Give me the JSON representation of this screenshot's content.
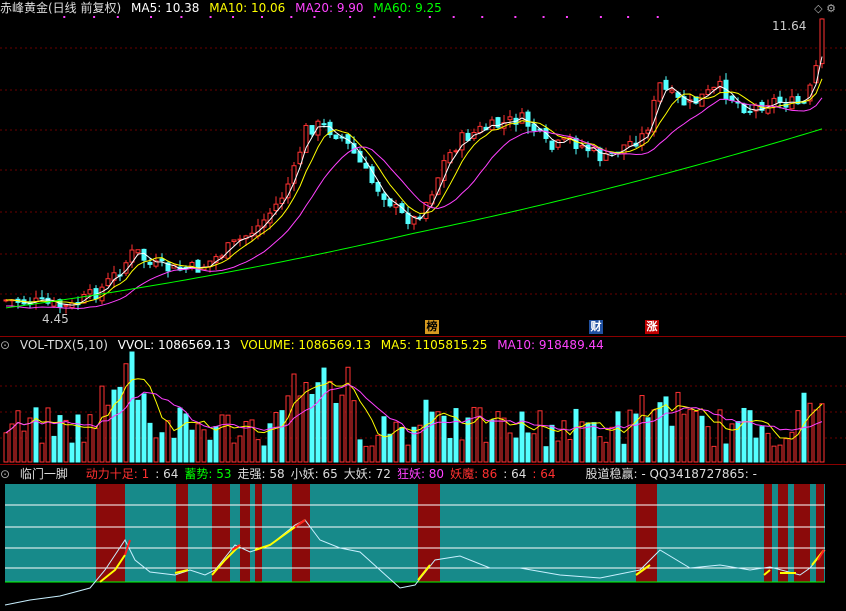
{
  "main": {
    "title": "赤峰黄金(日线 前复权)",
    "ma": [
      {
        "label": "MA5: 10.38",
        "color": "#ffffff"
      },
      {
        "label": "MA10: 10.06",
        "color": "#ffff00"
      },
      {
        "label": "MA20: 9.90",
        "color": "#ff40ff"
      },
      {
        "label": "MA60: 9.25",
        "color": "#00ff00"
      }
    ],
    "high_label": "11.64",
    "low_label": "4.45",
    "markers": [
      {
        "text": "榜",
        "bg": "#d89a20",
        "fg": "#000"
      },
      {
        "text": "财",
        "bg": "#2050a0",
        "fg": "#fff"
      },
      {
        "text": "涨",
        "bg": "#c00000",
        "fg": "#fff"
      }
    ]
  },
  "volume": {
    "title": "VOL-TDX(5,10)",
    "vvol": "VVOL: 1086569.13",
    "volume": "VOLUME: 1086569.13",
    "ma5": "MA5: 1105815.25",
    "ma10": "MA10: 918489.44"
  },
  "indicator": {
    "title": "临门一脚",
    "items": [
      {
        "label": "动力十足",
        "value": ": 1",
        "color": "#ff3030"
      },
      {
        "label": "",
        "value": ": 64",
        "color": "#dddddd"
      },
      {
        "label": "蓄势",
        "value": ": 53",
        "color": "#00ff00"
      },
      {
        "label": "走强",
        "value": ": 58",
        "color": "#dddddd"
      },
      {
        "label": "小妖",
        "value": ": 65",
        "color": "#dddddd"
      },
      {
        "label": "大妖",
        "value": ": 72",
        "color": "#dddddd"
      },
      {
        "label": "狂妖",
        "value": ": 80",
        "color": "#ff40ff"
      },
      {
        "label": "妖魔",
        "value": ": 86",
        "color": "#ff3030"
      },
      {
        "label": "",
        "value": ": 64",
        "color": "#dddddd"
      },
      {
        "label": "",
        "value": ": 64",
        "color": "#ff3030"
      },
      {
        "label": "股道稳赢",
        "value": ": - QQ3418727865: -",
        "color": "#dddddd"
      }
    ]
  },
  "colors": {
    "up": "#ff3232",
    "down": "#54ffff",
    "bg": "#000000",
    "grid": "#8b0000"
  }
}
